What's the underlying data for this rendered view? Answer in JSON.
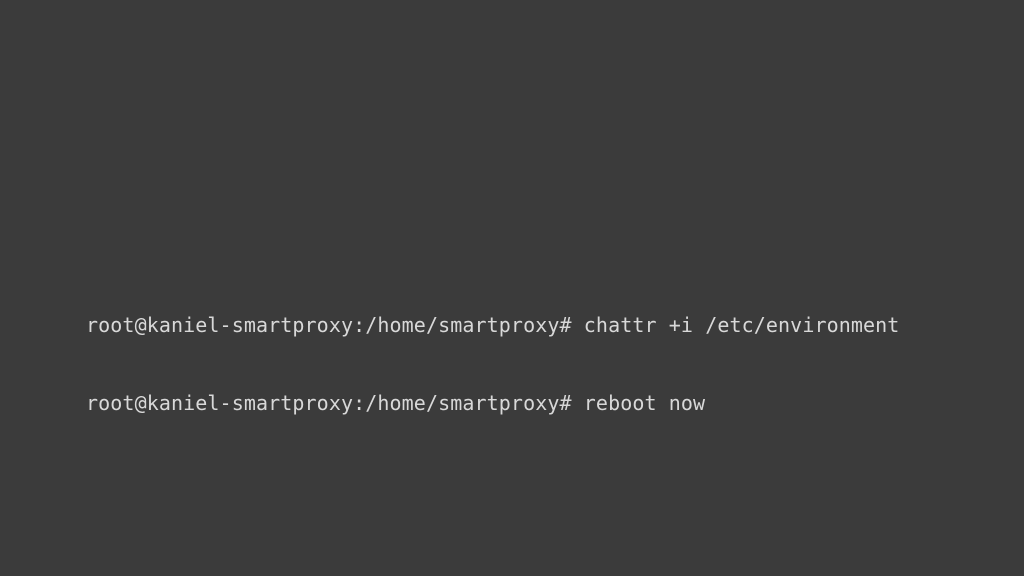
{
  "terminal": {
    "lines": [
      {
        "prompt": "root@kaniel-smartproxy:/home/smartproxy# ",
        "command": "chattr +i /etc/environment"
      },
      {
        "prompt": "root@kaniel-smartproxy:/home/smartproxy# ",
        "command": "reboot now"
      }
    ]
  }
}
